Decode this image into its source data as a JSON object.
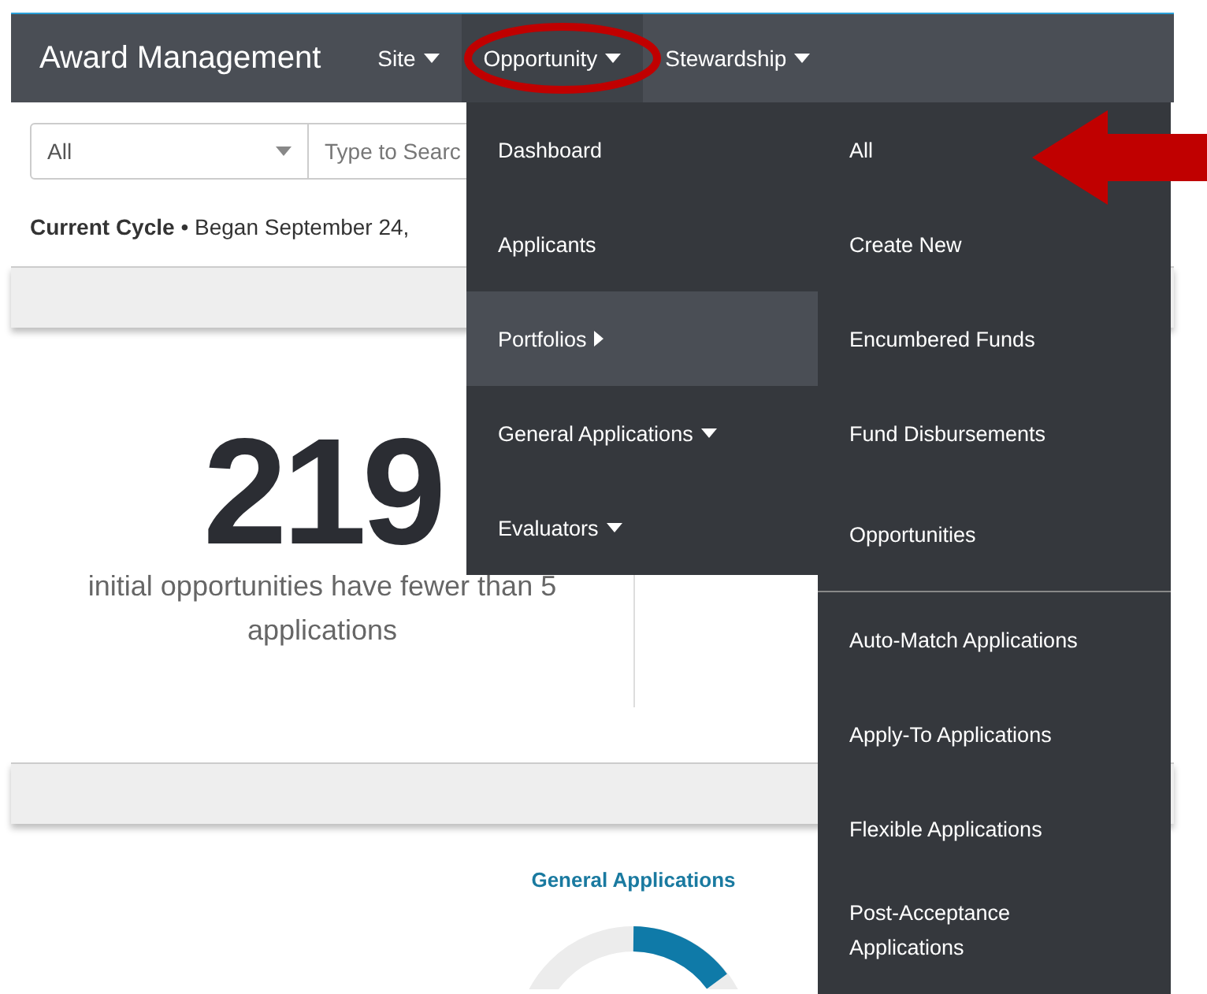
{
  "nav": {
    "title": "Award Management",
    "menus": [
      {
        "label": "Site",
        "selected": false
      },
      {
        "label": "Opportunity",
        "selected": true
      },
      {
        "label": "Stewardship",
        "selected": false
      }
    ]
  },
  "filter": {
    "select_value": "All",
    "search_placeholder": "Type to Searc"
  },
  "cycle": {
    "label": "Current Cycle",
    "text": "• Began September 24,"
  },
  "stat": {
    "value": "219",
    "caption": "initial opportunities have fewer than 5 applications"
  },
  "chart_title": "General Applications",
  "menu": {
    "items": [
      {
        "label": "Dashboard",
        "kind": "link",
        "selected": false
      },
      {
        "label": "Applicants",
        "kind": "link",
        "selected": false
      },
      {
        "label": "Portfolios",
        "kind": "submenu",
        "selected": true
      },
      {
        "label": "General Applications",
        "kind": "dropdown",
        "selected": false
      },
      {
        "label": "Evaluators",
        "kind": "dropdown",
        "selected": false
      }
    ]
  },
  "submenu": {
    "groups": [
      [
        "All",
        "Create New",
        "Encumbered Funds",
        "Fund Disbursements",
        "Opportunities"
      ],
      [
        "Auto-Match Applications",
        "Apply-To Applications",
        "Flexible Applications",
        "Post-Acceptance Applications"
      ]
    ]
  }
}
